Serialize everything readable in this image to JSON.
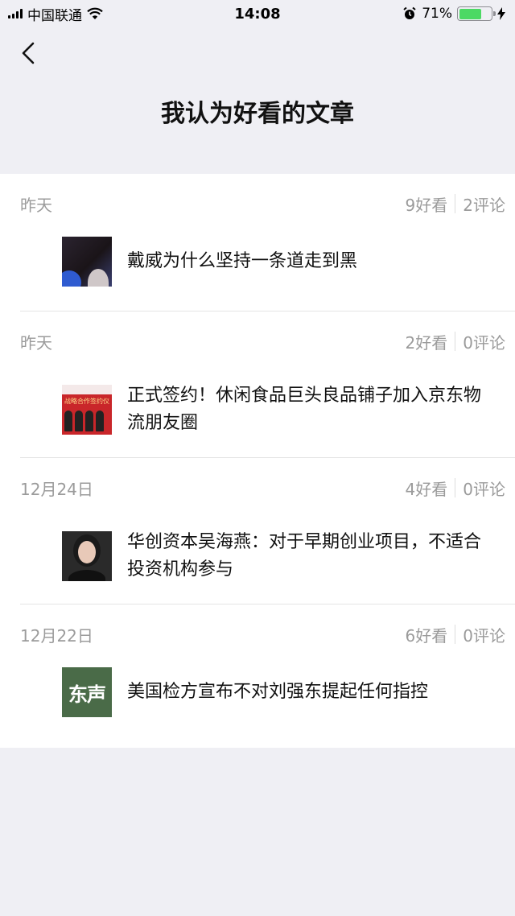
{
  "status_bar": {
    "carrier": "中国联通",
    "time": "14:08",
    "battery": "71%",
    "battery_level": 0.71
  },
  "nav": {
    "title": "我认为好看的文章"
  },
  "articles": [
    {
      "date": "昨天",
      "likes": "9好看",
      "comments": "2评论",
      "title": "戴威为什么坚持一条道走到黑"
    },
    {
      "date": "昨天",
      "likes": "2好看",
      "comments": "0评论",
      "title": "正式签约！休闲食品巨头良品铺子加入京东物流朋友圈",
      "thumb_text": "战略合作签约仪"
    },
    {
      "date": "12月24日",
      "likes": "4好看",
      "comments": "0评论",
      "title": "华创资本吴海燕：对于早期创业项目，不适合投资机构参与"
    },
    {
      "date": "12月22日",
      "likes": "6好看",
      "comments": "0评论",
      "title": "美国检方宣布不对刘强东提起任何指控",
      "thumb_text": "东声"
    }
  ],
  "colors": {
    "background": "#efeff4",
    "battery_green": "#4cd964",
    "meta_gray": "#9b9b9b"
  }
}
